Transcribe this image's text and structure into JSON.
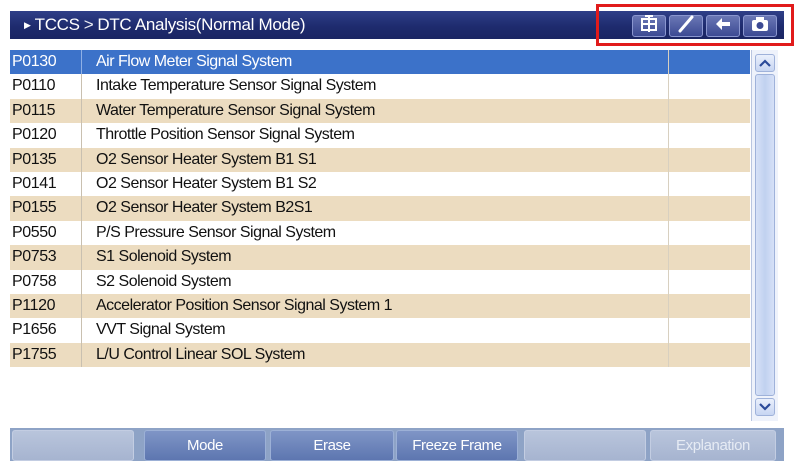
{
  "header": {
    "breadcrumb_root": "TCCS",
    "breadcrumb_separator": ">",
    "breadcrumb_current": "DTC Analysis(Normal Mode)",
    "toolbar_icons": [
      "data-tool-icon",
      "pen-icon",
      "back-arrow-icon",
      "camera-icon"
    ]
  },
  "dtc_rows": [
    {
      "code": "P0130",
      "description": "Air Flow Meter Signal System"
    },
    {
      "code": "P0110",
      "description": "Intake Temperature Sensor Signal System"
    },
    {
      "code": "P0115",
      "description": "Water Temperature Sensor Signal System"
    },
    {
      "code": "P0120",
      "description": "Throttle Position Sensor Signal System"
    },
    {
      "code": "P0135",
      "description": "O2 Sensor Heater System B1 S1"
    },
    {
      "code": "P0141",
      "description": "O2 Sensor Heater System B1 S2"
    },
    {
      "code": "P0155",
      "description": "O2 Sensor Heater System B2S1"
    },
    {
      "code": "P0550",
      "description": "P/S Pressure Sensor Signal System"
    },
    {
      "code": "P0753",
      "description": "S1 Solenoid System"
    },
    {
      "code": "P0758",
      "description": "S2 Solenoid System"
    },
    {
      "code": "P1120",
      "description": "Accelerator Position Sensor Signal System 1"
    },
    {
      "code": "P1656",
      "description": "VVT Signal System"
    },
    {
      "code": "P1755",
      "description": "L/U Control Linear SOL System"
    }
  ],
  "selected_row_index": 0,
  "bottom_buttons": {
    "blank1": "",
    "mode": "Mode",
    "erase": "Erase",
    "freeze_frame": "Freeze Frame",
    "blank2": "",
    "explanation": "Explanation"
  },
  "colors": {
    "title_bar": "#1e2b6e",
    "selected_row": "#3c72c9",
    "alt_row": "#ecdcc0",
    "highlight_box": "#e11b1b"
  }
}
